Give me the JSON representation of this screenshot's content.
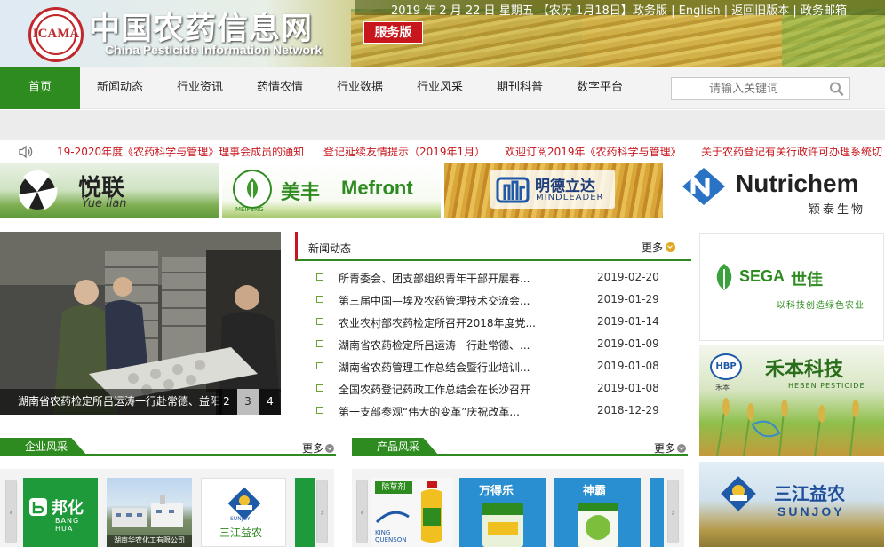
{
  "header": {
    "logo_text": "ICAMA",
    "title": "中国农药信息网",
    "subtitle": "China Pesticide Information Network",
    "service_badge": "服务版",
    "date": "2019 年 2 月 22 日 星期五 【",
    "lunar": "农历 1月18日",
    "date_end": "】",
    "links": [
      "政务版",
      "English",
      "返回旧版本",
      "政务邮箱"
    ],
    "link_sep": " | "
  },
  "nav": {
    "items": [
      {
        "label": "首页",
        "active": true
      },
      {
        "label": "新闻动态"
      },
      {
        "label": "行业资讯"
      },
      {
        "label": "药情农情"
      },
      {
        "label": "行业数据"
      },
      {
        "label": "行业风采"
      },
      {
        "label": "期刊科普"
      },
      {
        "label": "数字平台"
      }
    ],
    "search_placeholder": "请输入关键词",
    "search_icon": "search-icon"
  },
  "ticker": {
    "icon": "speaker-icon",
    "items": [
      "19-2020年度《农药科学与管理》理事会成员的通知",
      "登记延续友情提示（2019年1月）",
      "欢迎订阅2019年《农药科学与管理》",
      "关于农药登记有关行政许可办理系统切"
    ]
  },
  "ads": {
    "yuelian": {
      "cn": "悦联",
      "en": "Yue lian"
    },
    "mefront": {
      "cn": "美丰",
      "en": "Mefront",
      "small": "MEIFENG"
    },
    "mindleader": {
      "cn": "明德立达",
      "en": "MINDLEADER"
    },
    "nutrichem": {
      "en": "Nutrichem",
      "cn": "颖泰生物"
    }
  },
  "slideshow": {
    "caption": "湖南省农药检定所吕运涛一行赴常德、益阳",
    "numbers": [
      "2",
      "3",
      "4"
    ],
    "active": "3"
  },
  "news": {
    "title": "新闻动态",
    "more": "更多",
    "items": [
      {
        "title": "所青委会、团支部组织青年干部开展春...",
        "date": "2019-02-20"
      },
      {
        "title": "第三届中国—埃及农药管理技术交流会...",
        "date": "2019-01-29"
      },
      {
        "title": "农业农村部农药检定所召开2018年度党...",
        "date": "2019-01-14"
      },
      {
        "title": "湖南省农药检定所吕运涛一行赴常德、...",
        "date": "2019-01-09"
      },
      {
        "title": "湖南省农药管理工作总结会暨行业培训...",
        "date": "2019-01-08"
      },
      {
        "title": "全国农药登记药政工作总结会在长沙召开",
        "date": "2019-01-08"
      },
      {
        "title": "第一支部参观“伟大的变革”庆祝改革...",
        "date": "2018-12-29"
      }
    ]
  },
  "side_ads": {
    "sega": {
      "en": "SEGA",
      "cn": "世佳",
      "slogan": "以科技创造绿色农业"
    },
    "heben": {
      "badge": "HBP",
      "cn": "禾本科技",
      "en": "HEBEN PESTICIDE",
      "small": "禾本"
    },
    "sunjoy": {
      "cn": "三江益农",
      "en": "SUNJOY"
    }
  },
  "sections": {
    "company": {
      "title": "企业风采",
      "more": "更多"
    },
    "product": {
      "title": "产品风采",
      "more": "更多"
    }
  },
  "company_tiles": {
    "banghua": {
      "cn": "邦化",
      "en": "BANG HUA"
    },
    "sunjoy": {
      "cn": "三江益农",
      "en": "SUNJOY"
    },
    "factory_caption": "湖南华农化工有限公司"
  },
  "product_tiles": {
    "weedkiller": {
      "tag": "除草剂",
      "brand": "KING QUENSON"
    },
    "wandele": {
      "cn": "万得乐"
    },
    "shenba": {
      "cn": "神霸"
    }
  },
  "arrows": {
    "left": "‹",
    "right": "›"
  },
  "colors": {
    "green": "#2e8b1f",
    "red": "#c8161d",
    "gold": "#e0a826"
  }
}
